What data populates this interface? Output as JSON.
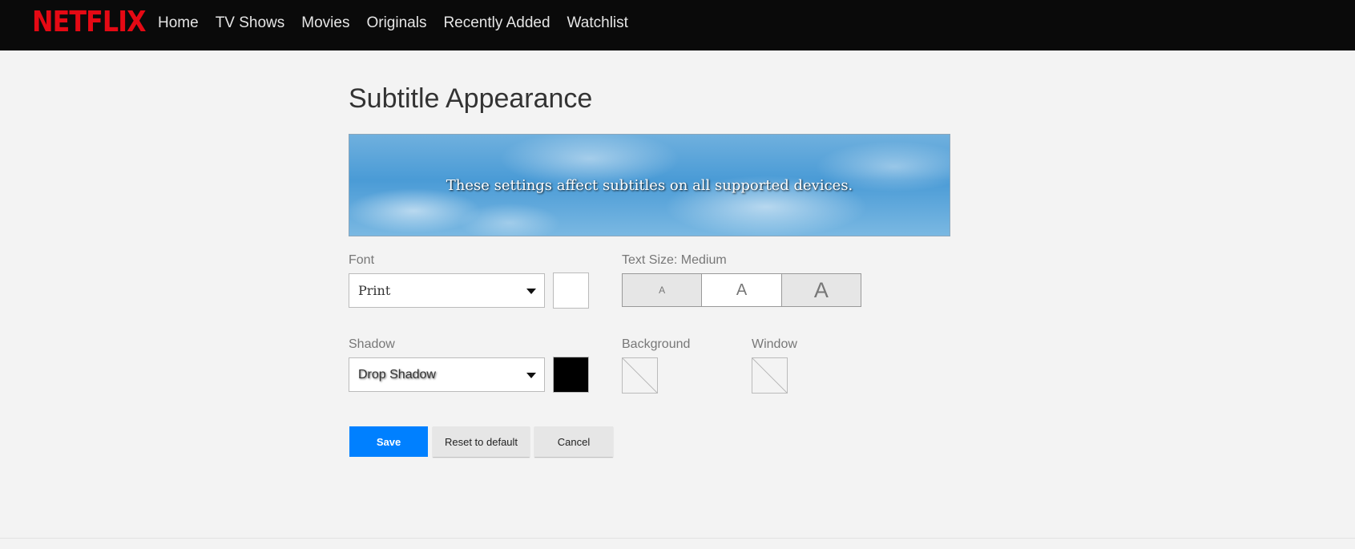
{
  "header": {
    "logo": "NETFLIX",
    "nav": [
      "Home",
      "TV Shows",
      "Movies",
      "Originals",
      "Recently Added",
      "Watchlist"
    ]
  },
  "page": {
    "title": "Subtitle Appearance",
    "preview_text": "These settings affect subtitles on all supported devices."
  },
  "font": {
    "label": "Font",
    "value": "Print",
    "color": "#ffffff"
  },
  "text_size": {
    "label": "Text Size: Medium",
    "options": [
      "A",
      "A",
      "A"
    ],
    "selected": "Medium"
  },
  "shadow": {
    "label": "Shadow",
    "value": "Drop Shadow",
    "color": "#000000"
  },
  "background": {
    "label": "Background",
    "color": "none"
  },
  "window": {
    "label": "Window",
    "color": "none"
  },
  "actions": {
    "save": "Save",
    "reset": "Reset to default",
    "cancel": "Cancel"
  },
  "colors": {
    "brand": "#e50914",
    "primary_button": "#0080ff"
  }
}
